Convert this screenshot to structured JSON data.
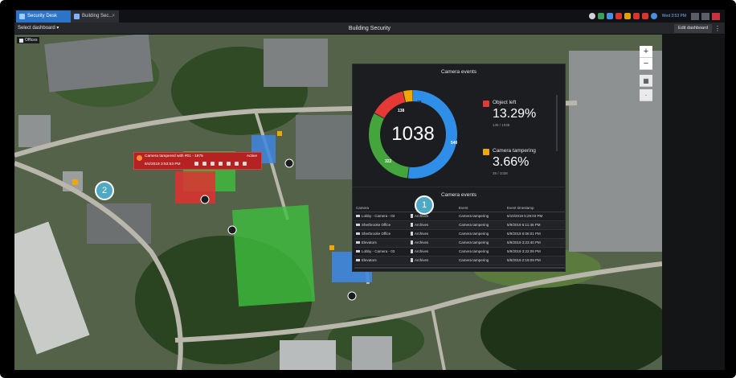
{
  "titlebar": {
    "tabs": [
      {
        "label": "Security Desk"
      },
      {
        "label": "Building Sec..."
      }
    ],
    "tab_close": "×",
    "clock": "Wed 3:53 PM"
  },
  "header": {
    "select_dashboard": "Select dashboard ▾",
    "title": "Building Security",
    "edit_dashboard": "Edit dashboard",
    "more": "⋮"
  },
  "map": {
    "area_label": "Offices",
    "zoom_in": "+",
    "zoom_out": "−",
    "layers": "▦",
    "pin": "·"
  },
  "camera_events_widget": {
    "title": "Camera events",
    "total": "1038",
    "segments": [
      {
        "label": "540",
        "value": 540,
        "color": "#2f8fe8"
      },
      {
        "label": "322",
        "value": 322,
        "color": "#44a53c"
      },
      {
        "label": "138",
        "value": 138,
        "color": "#e53935"
      },
      {
        "label": "38",
        "value": 38,
        "color": "#f0a800"
      }
    ],
    "stats": [
      {
        "name": "Object left",
        "percent": "13.29%",
        "ratio": "138 / 1038",
        "color": "#e53935"
      },
      {
        "name": "Camera tampering",
        "percent": "3.66%",
        "ratio": "38 / 1038",
        "color": "#f0a800"
      }
    ]
  },
  "camera_events_table": {
    "title": "Camera events",
    "columns": [
      "Camera",
      "",
      "Event",
      "Event timestamp"
    ],
    "rows": [
      {
        "camera": "Lobby - Camera - 03",
        "archive": "Archives",
        "event": "Camera tampering",
        "timestamp": "5/10/2019 5:29:03 PM"
      },
      {
        "camera": "Sherbrooke Office",
        "archive": "Archives",
        "event": "Camera tampering",
        "timestamp": "5/9/2019 6:11:46 PM"
      },
      {
        "camera": "Sherbrooke Office",
        "archive": "Archives",
        "event": "Camera tampering",
        "timestamp": "5/9/2019 6:06:01 PM"
      },
      {
        "camera": "Elevators",
        "archive": "Archives",
        "event": "Camera tampering",
        "timestamp": "5/9/2019 3:23:40 PM"
      },
      {
        "camera": "Lobby - Camera - 03",
        "archive": "Archives",
        "event": "Camera tampering",
        "timestamp": "5/9/2019 3:22:09 PM"
      },
      {
        "camera": "Elevators",
        "archive": "Archives",
        "event": "Camera tampering",
        "timestamp": "5/9/2019 2:19:09 PM"
      }
    ]
  },
  "alarm": {
    "title": "Camera tampered with #01 - 1975",
    "state": "Active",
    "time": "6/4/2019 3:53:53 PM"
  },
  "callouts": {
    "one": "1",
    "two": "2"
  },
  "colors": {
    "accent": "#2b74c7",
    "alarm": "#b52222",
    "callout": "#4fa9c5"
  }
}
